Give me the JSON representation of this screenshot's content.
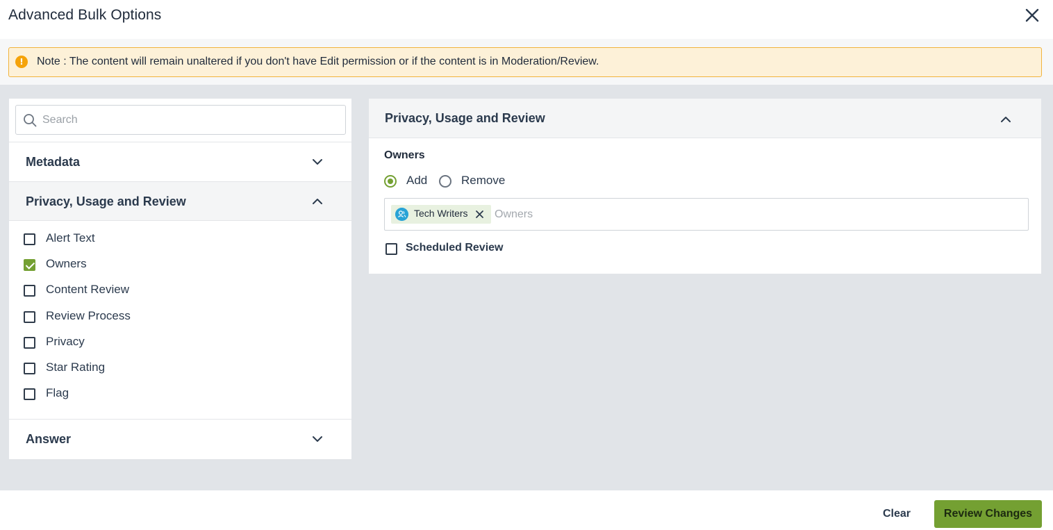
{
  "dialog": {
    "title": "Advanced Bulk Options",
    "close_icon": "close-icon"
  },
  "note": {
    "icon": "info-icon",
    "text": "Note : The content will remain unaltered if you don't have Edit permission or if the content is in Moderation/Review."
  },
  "left_panel": {
    "search": {
      "placeholder": "Search",
      "value": "",
      "icon": "search-icon"
    },
    "sections": [
      {
        "label": "Metadata",
        "expanded": false,
        "icon": "chevron-down-icon"
      },
      {
        "label": "Privacy, Usage and Review",
        "expanded": true,
        "icon": "chevron-up-icon"
      },
      {
        "label": "Answer",
        "expanded": false,
        "icon": "chevron-down-icon"
      }
    ],
    "privacy_items": [
      {
        "label": "Alert Text",
        "checked": false
      },
      {
        "label": "Owners",
        "checked": true
      },
      {
        "label": "Content Review",
        "checked": false
      },
      {
        "label": "Review Process",
        "checked": false
      },
      {
        "label": "Privacy",
        "checked": false
      },
      {
        "label": "Star Rating",
        "checked": false
      },
      {
        "label": "Flag",
        "checked": false
      }
    ]
  },
  "right_panel": {
    "title": "Privacy, Usage and Review",
    "collapse_icon": "chevron-up-icon",
    "owners": {
      "label": "Owners",
      "options": [
        {
          "label": "Add",
          "selected": true
        },
        {
          "label": "Remove",
          "selected": false
        }
      ],
      "chips": [
        {
          "label": "Tech Writers",
          "icon": "group-avatar-icon"
        }
      ],
      "input_placeholder": "Owners"
    },
    "scheduled_review": {
      "label": "Scheduled Review",
      "checked": false
    }
  },
  "footer": {
    "clear_label": "Clear",
    "review_label": "Review Changes"
  },
  "colors": {
    "accent": "#74a032",
    "note_bg": "#fdf1d8",
    "note_border": "#f1b33c",
    "note_icon": "#f5a30a",
    "body_bg": "#e1e4e8",
    "chip_avatar": "#29a3d6"
  }
}
